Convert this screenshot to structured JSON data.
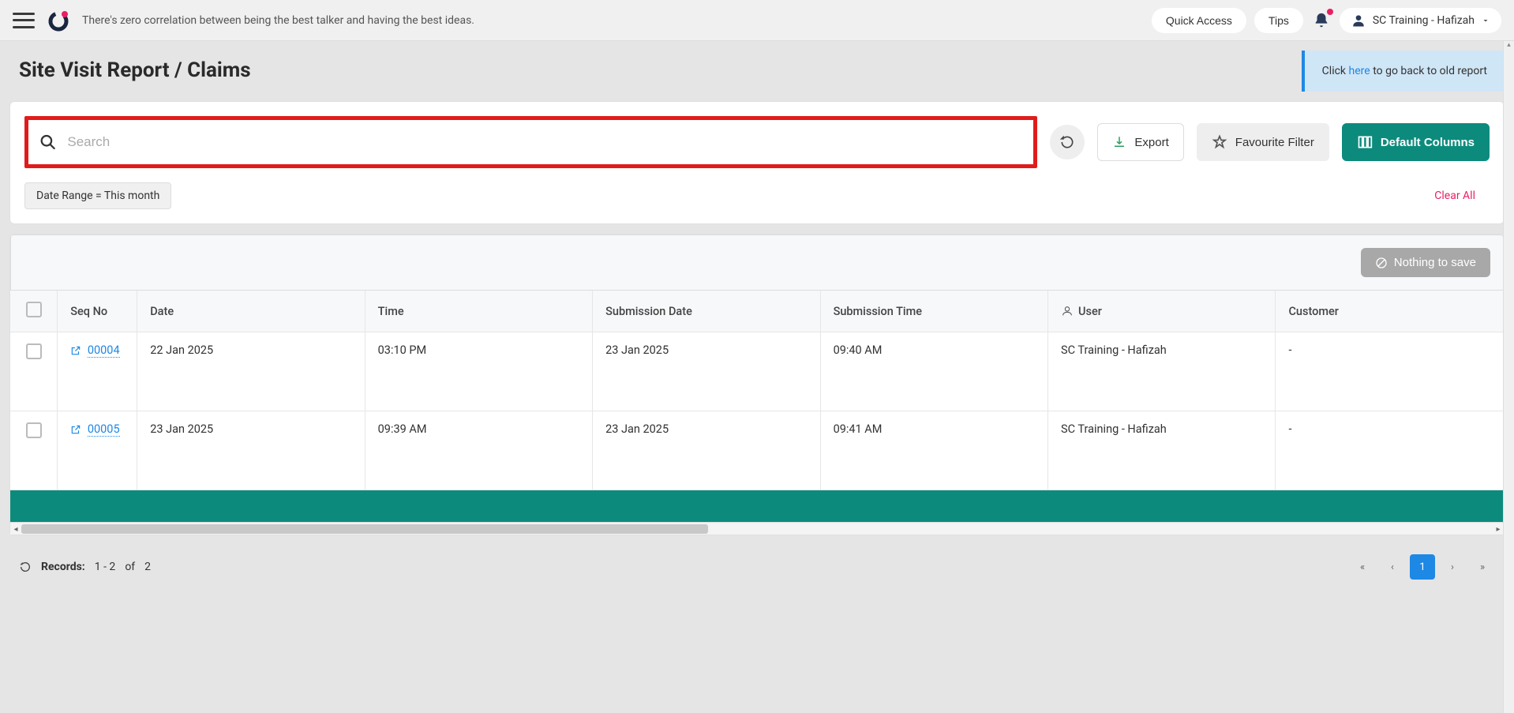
{
  "header": {
    "quote": "There's zero correlation between being the best talker and having the best ideas.",
    "quick_access": "Quick Access",
    "tips": "Tips",
    "user_name": "SC Training - Hafizah"
  },
  "page": {
    "title": "Site Visit Report / Claims",
    "banner_prefix": "Click",
    "banner_link": "here",
    "banner_suffix": "to go back to old report"
  },
  "search": {
    "placeholder": "Search"
  },
  "actions": {
    "export": "Export",
    "favourite_filter": "Favourite Filter",
    "default_columns": "Default Columns"
  },
  "filters": {
    "date_range_chip": "Date Range   =   This month",
    "clear_all": "Clear All"
  },
  "table": {
    "nothing_to_save": "Nothing to save",
    "headers": {
      "seq": "Seq No",
      "date": "Date",
      "time": "Time",
      "sub_date": "Submission Date",
      "sub_time": "Submission Time",
      "user": "User",
      "customer": "Customer"
    },
    "rows": [
      {
        "seq": "00004",
        "date": "22 Jan 2025",
        "time": "03:10 PM",
        "sub_date": "23 Jan 2025",
        "sub_time": "09:40 AM",
        "user": "SC Training - Hafizah",
        "customer": "-"
      },
      {
        "seq": "00005",
        "date": "23 Jan 2025",
        "time": "09:39 AM",
        "sub_date": "23 Jan 2025",
        "sub_time": "09:41 AM",
        "user": "SC Training - Hafizah",
        "customer": "-"
      }
    ]
  },
  "footer": {
    "records_label": "Records:",
    "records_range": "1 - 2",
    "of_label": "of",
    "total": "2",
    "current_page": "1"
  }
}
